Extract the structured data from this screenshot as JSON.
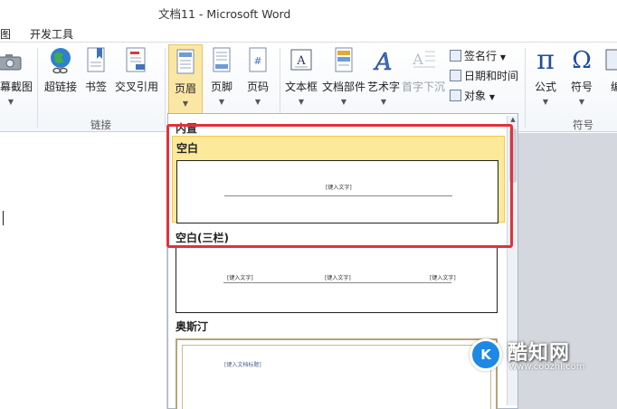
{
  "window": {
    "title": "文档11 - Microsoft Word"
  },
  "menu_tabs": [
    "图",
    "开发工具"
  ],
  "ribbon": {
    "links_group": {
      "label": "链接",
      "buttons": [
        "屏幕截图",
        "超链接",
        "书签",
        "交叉引用"
      ]
    },
    "header_footer": {
      "header": "页眉",
      "footer": "页脚",
      "page_number": "页码"
    },
    "text_group": {
      "textbox": "文本框",
      "quick_parts": "文档部件",
      "wordart": "艺术字",
      "dropcap": "首字下沉"
    },
    "small_items": [
      "签名行",
      "日期和时间",
      "对象"
    ],
    "symbols_group": {
      "label": "符号",
      "equation": "公式",
      "symbol": "符号",
      "number": "编"
    }
  },
  "gallery": {
    "category": "内置",
    "items": [
      {
        "name": "空白",
        "placeholder": "[键入文字]",
        "highlighted": true
      },
      {
        "name": "空白(三栏)",
        "placeholders": [
          "[键入文字]",
          "[键入文字]",
          "[键入文字]"
        ]
      },
      {
        "name": "奥斯汀",
        "placeholder": "[键入文档标题]"
      }
    ]
  },
  "watermark": {
    "brand": "酷知网",
    "url": "www.coozhi.com",
    "logo_text": "K"
  },
  "colors": {
    "highlight": "#fde99a",
    "callout_border": "#e0323c",
    "brand_blue": "#1e88e5"
  }
}
